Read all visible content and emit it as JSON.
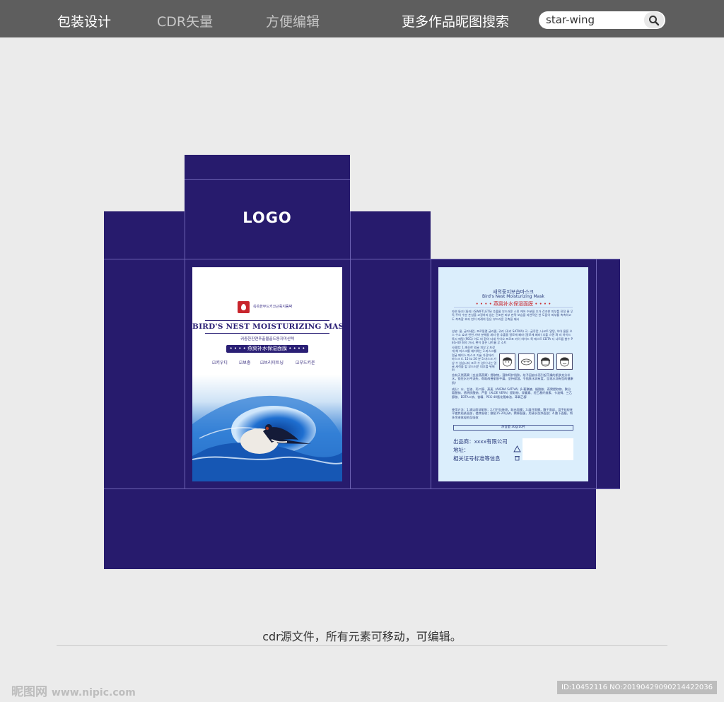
{
  "top_nav": {
    "items": [
      "包装设计",
      "CDR矢量",
      "方便编辑",
      "更多作品昵图搜索"
    ],
    "search_value": "star-wing"
  },
  "dieline": {
    "logo": "LOGO",
    "colors": {
      "box": "#271b6d",
      "fold_line": "#6d63b3",
      "back_panel": "#dbeefc",
      "accent_red": "#c8282e"
    }
  },
  "front_panel": {
    "brand_small": "쏙쏙한부드키코근육지움박",
    "title": "BIRD'S NEST MOISTURIZING MASK",
    "korean_line": "귀중한진연추출물골드동지미신텍",
    "pill": "• • • • 燕窝补水保湿面膜 • • • •",
    "features": [
      "☑키우디",
      "☑보충",
      "☑브리이트닝",
      "☑부드키운"
    ]
  },
  "back_panel": {
    "kor_title": "새의둥지보습마스크",
    "en_title": "Bird's Nest Moisturizing Mask",
    "cn_title": "• • • • 燕窝补水保湿面膜 • • • •",
    "kor_text_1": "자연 둥지 (둥지) (SWIFTLETS) 추출물 부드러운 스킨 케어 수분을 추가 건조한 피부를 진정 줄 무독 주어 수분 손실을 고정하지 않는 건조한 피부 판막 보습을 자연적인 한 도움이 피부를 촉촉하고도 촉촉할 효과 천이 지례의 링은 부드러운 긴축을 제시",
    "kor_text_2": "성분: 물, 글리세린, 프로필렌 글리콜, 귀리 (귀리 SATIVA) 곡 · 글루칸, 나코트 알탕, 히아 물론 오스 수소 효과 천연 가바 분해물 세리 원 추출물 알로에 페라 (알로에 페라) 추출 스탠 화 리 하이드 록시 에틸 (PEG) 이도 바 환의 다세 우이오 프로포 카이 하이드 록 에스트 EDTA 디 나트륨 향수 PEG-40 회의 가서, 편이 좋은 나트륨 무 소트",
    "kor_text_3": "사용법: 1.깨끗한 얼굴 피부 2.포장 개 해 마스크를 제거하는 3.마스크를 얼굴 페이스 마스크 기술 가장자리 마스크 4. 15 to 20 분 5.마스크 가 상 수 있습니다 조르 수 있어 나는 얼굴 세척을 할 부드러운 피부를 위해 편",
    "cn_text": "含有天然燕窝（金丝燕燕窝）提取物，温和呵护肌肤，给予因缺水而引起干燥的肌肤充分补水，锁住水分不流失，帮助改善肌肤干燥，坚持保湿，令肌肤水润有度，呈现水润有型的健康肌！",
    "cn_ingredients": "成分：水、甘油、丙二醇、燕麦（AVENA SATIVA）β-葡聚糖、烟酰胺、燕窝提取物、聚谷氨酸钠、透明质酸钠、芦荟（ALOE VERA）提取物、尿囊素、羟乙基纤维素、卡波姆、三乙醇胺、EDTA二钠、香精、PEG-40氢化蓖麻油、苯氧乙醇",
    "cn_usage": "使用方法：1.清洁面部肌肤；2.打开包装袋，取出面膜；3.展开面膜，敷于面部，用手轻轻抚平使其贴紧面部，使其吸收；敷贴15-20分钟，揭掉面膜，用清水洗净面部；4.敷下面膜，将多余液体轻拍至吸收",
    "net_content": "净含量 30g/10片",
    "maker_lines": [
      "出品商：xxxx有限公司",
      "地址：",
      "相关证号标准等信息"
    ]
  },
  "caption": "cdr源文件，所有元素可移动，可编辑。",
  "watermark": {
    "left_cn": "昵图网",
    "left_url": "www.nipic.com",
    "right": "ID:10452116 NO:20190429090214422036"
  }
}
